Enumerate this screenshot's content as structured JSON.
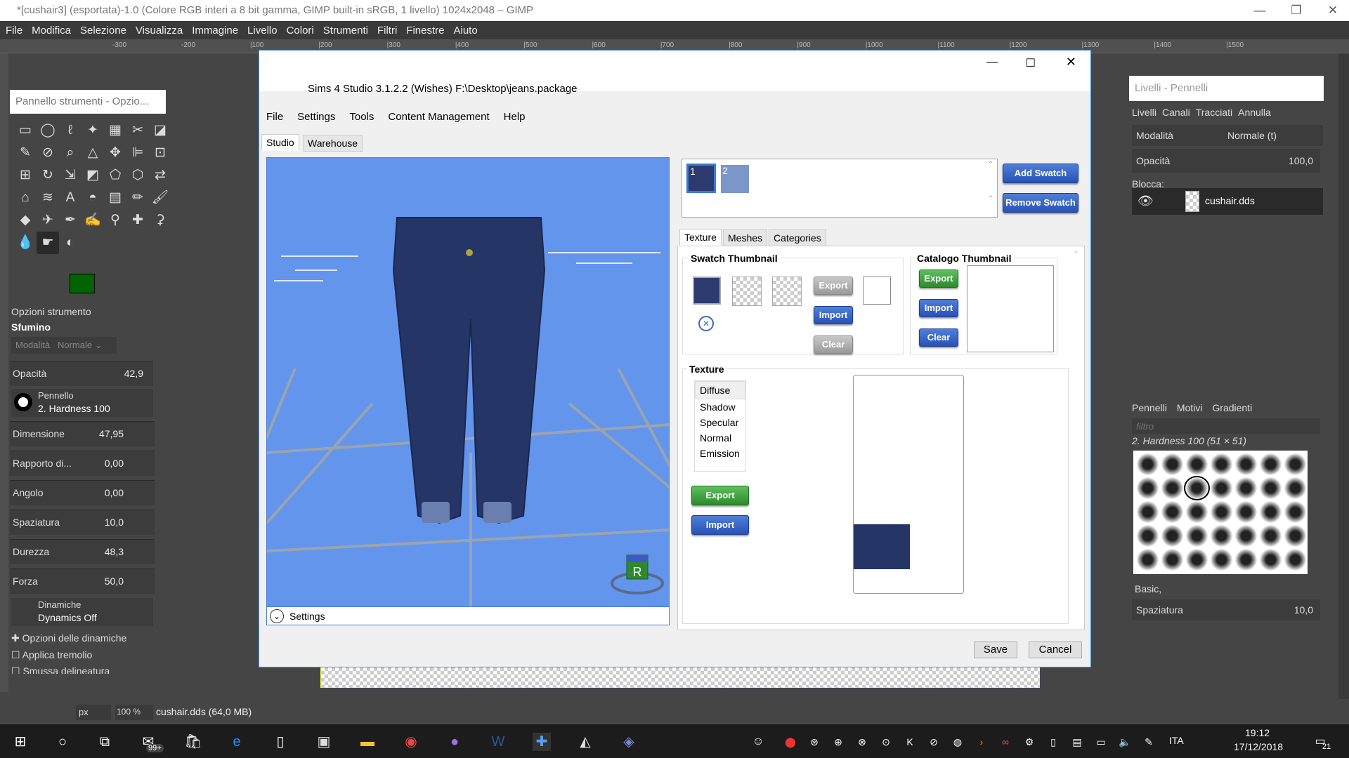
{
  "gimp": {
    "title": "*[cushair3] (esportata)-1.0 (Colore RGB interi a 8 bit gamma, GIMP built-in sRGB, 1 livello) 1024x2048 – GIMP",
    "menu": [
      "File",
      "Modifica",
      "Selezione",
      "Visualizza",
      "Immagine",
      "Livello",
      "Colori",
      "Strumenti",
      "Filtri",
      "Finestre",
      "Aiuto"
    ],
    "ruler_labels": [
      "-300",
      "-200",
      "|100",
      "|200",
      "|300",
      "|400",
      "|500",
      "|600",
      "|700",
      "|800",
      "|900",
      "|1000",
      "|1100",
      "|1200",
      "|1300",
      "|1400",
      "|1500"
    ],
    "toolbox": {
      "header": "Pannello strumenti - Opzio...",
      "tool_options_title": "Opzioni strumento",
      "tool_name": "Sfumino",
      "mode_label": "Modalità",
      "mode_value": "Normale",
      "options": [
        {
          "label": "Opacità",
          "value": "42,9"
        },
        {
          "label": "Dimensione",
          "value": "47,95"
        },
        {
          "label": "Rapporto di...",
          "value": "0,00"
        },
        {
          "label": "Angolo",
          "value": "0,00"
        },
        {
          "label": "Spaziatura",
          "value": "10,0"
        },
        {
          "label": "Durezza",
          "value": "48,3"
        },
        {
          "label": "Forza",
          "value": "50,0"
        }
      ],
      "brush_label": "Pennello",
      "brush_value": "2. Hardness 100",
      "dynamics_label": "Dinamiche",
      "dynamics_value": "Dynamics Off",
      "dyn_options": "Opzioni delle dinamiche",
      "jitter": "Applica tremolio",
      "smooth": "Smussa delineatura",
      "fg_color": "#006400",
      "bg_color": "#ffffff"
    },
    "status": {
      "unit": "px",
      "zoom": "100 %",
      "file_info": "cushair.dds (64,0 MB)"
    },
    "layers": {
      "header": "Livelli - Pennelli",
      "tabs": [
        "Livelli",
        "Canali",
        "Tracciati",
        "Annulla"
      ],
      "mode_label": "Modalità",
      "mode_value": "Normale (t)",
      "opacity_label": "Opacità",
      "opacity_value": "100,0",
      "lock_label": "Blocca:",
      "layer_name": "cushair.dds",
      "brush_tabs": [
        "Pennelli",
        "Motivi",
        "Gradienti"
      ],
      "filter_placeholder": "filtro",
      "brush_title": "2. Hardness 100 (51 × 51)",
      "preset": "Basic,",
      "spacing_label": "Spaziatura",
      "spacing_value": "10,0"
    }
  },
  "studio": {
    "title": "Sims 4 Studio 3.1.2.2 (Wishes)  F:\\Desktop\\jeans.package",
    "menu": [
      "File",
      "Settings",
      "Tools",
      "Content Management",
      "Help"
    ],
    "tabs": [
      "Studio",
      "Warehouse"
    ],
    "swatches": [
      "1",
      "2"
    ],
    "swatch_colors": [
      "#2d3a6e",
      "#7b96c8"
    ],
    "add_swatch": "Add Swatch",
    "remove_swatch": "Remove Swatch",
    "subtabs": [
      "Texture",
      "Meshes",
      "Categories"
    ],
    "swatch_thumbnail": "Swatch Thumbnail",
    "catalog_thumbnail": "Catalogo Thumbnail",
    "export": "Export",
    "import": "Import",
    "clear": "Clear",
    "texture_label": "Texture",
    "texture_list": [
      "Diffuse",
      "Shadow",
      "Specular",
      "Normal",
      "Emission"
    ],
    "settings_label": "Settings",
    "save": "Save",
    "cancel": "Cancel",
    "gizmo_letter": "R"
  },
  "taskbar": {
    "badge": "99+",
    "language": "ITA",
    "time": "19:12",
    "date": "17/12/2018",
    "notifications": "21"
  }
}
